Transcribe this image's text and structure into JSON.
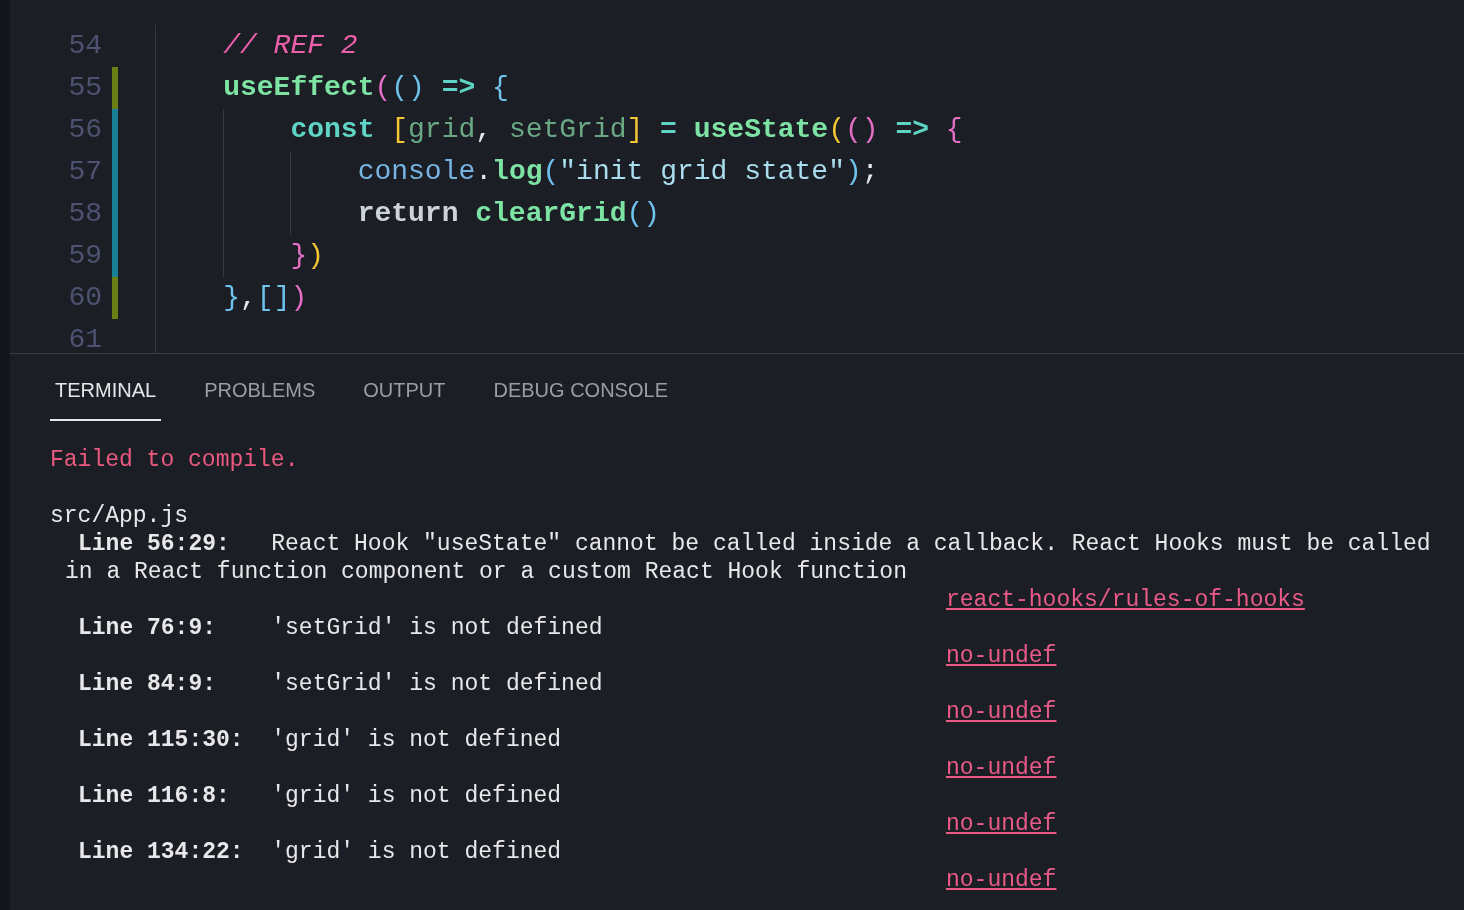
{
  "editor": {
    "lines": [
      {
        "number": "54",
        "tokens": [
          {
            "kind": "comment",
            "text": "    // REF 2"
          }
        ]
      },
      {
        "number": "55",
        "color": "#6b7f14",
        "tokens": [
          {
            "kind": "function",
            "text": "    useEffect"
          },
          {
            "kind": "bracket_pink",
            "text": "("
          },
          {
            "kind": "bracket_blue",
            "text": "()"
          },
          {
            "kind": "operator",
            "text": " => "
          },
          {
            "kind": "bracket_blue",
            "text": "{"
          }
        ]
      },
      {
        "number": "56",
        "color": "#1a7f96",
        "tokens": [
          {
            "kind": "keyword",
            "text": "        const"
          },
          {
            "kind": "bracket_yellow",
            "text": " ["
          },
          {
            "kind": "variable",
            "text": "grid"
          },
          {
            "kind": "punct",
            "text": ", "
          },
          {
            "kind": "variable",
            "text": "setGrid"
          },
          {
            "kind": "bracket_yellow",
            "text": "]"
          },
          {
            "kind": "operator",
            "text": " = "
          },
          {
            "kind": "function",
            "text": "useState"
          },
          {
            "kind": "bracket_yellow",
            "text": "("
          },
          {
            "kind": "bracket_pink",
            "text": "()"
          },
          {
            "kind": "operator",
            "text": " => "
          },
          {
            "kind": "bracket_pink",
            "text": "{"
          }
        ]
      },
      {
        "number": "57",
        "color": "#1a7f96",
        "tokens": [
          {
            "kind": "object",
            "text": "            console"
          },
          {
            "kind": "punct",
            "text": "."
          },
          {
            "kind": "function",
            "text": "log"
          },
          {
            "kind": "bracket_blue",
            "text": "("
          },
          {
            "kind": "string",
            "text": "\"init grid state\""
          },
          {
            "kind": "bracket_blue",
            "text": ")"
          },
          {
            "kind": "punct",
            "text": ";"
          }
        ]
      },
      {
        "number": "58",
        "color": "#1a7f96",
        "tokens": [
          {
            "kind": "control",
            "text": "            return"
          },
          {
            "kind": "function",
            "text": " clearGrid"
          },
          {
            "kind": "bracket_blue",
            "text": "()"
          }
        ]
      },
      {
        "number": "59",
        "color": "#1a7f96",
        "tokens": [
          {
            "kind": "bracket_pink",
            "text": "        }"
          },
          {
            "kind": "bracket_yellow",
            "text": ")"
          }
        ]
      },
      {
        "number": "60",
        "color": "#6b7f14",
        "tokens": [
          {
            "kind": "bracket_blue",
            "text": "    }"
          },
          {
            "kind": "punct",
            "text": ","
          },
          {
            "kind": "bracket_blue",
            "text": "[]"
          },
          {
            "kind": "bracket_pink",
            "text": ")"
          }
        ]
      },
      {
        "number": "61"
      }
    ]
  },
  "panel": {
    "tabs": [
      {
        "label": "TERMINAL",
        "selected": true
      },
      {
        "label": "PROBLEMS",
        "selected": false
      },
      {
        "label": "OUTPUT",
        "selected": false
      },
      {
        "label": "DEBUG CONSOLE",
        "selected": false
      }
    ],
    "terminal": {
      "heading": "Failed to compile.",
      "file": "src/App.js",
      "errors": [
        {
          "message": "**Line 56:29:**   React Hook \"useState\" cannot be called inside a callback. React Hooks must be called in a React function component or a custom React Hook function",
          "rule": "react-hooks/rules-of-hooks"
        },
        {
          "message": "**Line 76:9:**    'setGrid' is not defined",
          "rule": "no-undef"
        },
        {
          "message": "**Line 84:9:**    'setGrid' is not defined",
          "rule": "no-undef"
        },
        {
          "message": "**Line 115:30:**  'grid' is not defined",
          "rule": "no-undef"
        },
        {
          "message": "**Line 116:8:**   'grid' is not defined",
          "rule": "no-undef"
        },
        {
          "message": "**Line 134:22:**  'grid' is not defined",
          "rule": "no-undef"
        }
      ]
    }
  }
}
